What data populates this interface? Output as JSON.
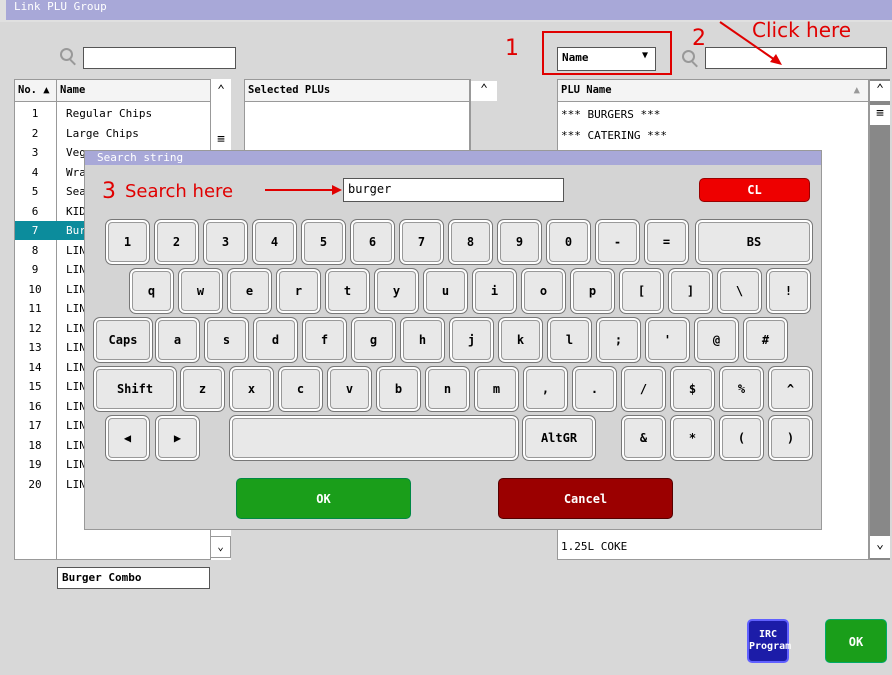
{
  "window": {
    "title": "Link PLU Group"
  },
  "left": {
    "headers": {
      "no": "No.",
      "name": "Name",
      "selected": "Selected PLUs"
    },
    "rows": [
      {
        "no": "1",
        "name": "Regular Chips"
      },
      {
        "no": "2",
        "name": "Large Chips"
      },
      {
        "no": "3",
        "name": "Veg"
      },
      {
        "no": "4",
        "name": "Wra"
      },
      {
        "no": "5",
        "name": "Sea"
      },
      {
        "no": "6",
        "name": "KID"
      },
      {
        "no": "7",
        "name": "Bur"
      },
      {
        "no": "8",
        "name": "LIN"
      },
      {
        "no": "9",
        "name": "LIN"
      },
      {
        "no": "10",
        "name": "LIN"
      },
      {
        "no": "11",
        "name": "LIN"
      },
      {
        "no": "12",
        "name": "LIN"
      },
      {
        "no": "13",
        "name": "LIN"
      },
      {
        "no": "14",
        "name": "LIN"
      },
      {
        "no": "15",
        "name": "LIN"
      },
      {
        "no": "16",
        "name": "LIN"
      },
      {
        "no": "17",
        "name": "LIN"
      },
      {
        "no": "18",
        "name": "LIN"
      },
      {
        "no": "19",
        "name": "LIN"
      },
      {
        "no": "20",
        "name": "LINK PLU GROUP 20"
      }
    ],
    "selected_index": 6,
    "group_name_value": "Burger Combo"
  },
  "right": {
    "filter_select": "Name",
    "search_value": "",
    "header": "PLU Name",
    "rows": [
      "*** BURGERS ***",
      "*** CATERING ***"
    ],
    "last_row": "1.25L COKE"
  },
  "dialog": {
    "title": "Search string",
    "value": "burger",
    "cl": "CL",
    "row1": [
      "1",
      "2",
      "3",
      "4",
      "5",
      "6",
      "7",
      "8",
      "9",
      "0",
      "-",
      "=",
      "BS"
    ],
    "row2": [
      "q",
      "w",
      "e",
      "r",
      "t",
      "y",
      "u",
      "i",
      "o",
      "p",
      "[",
      "]",
      "\\",
      "!"
    ],
    "row3": [
      "Caps",
      "a",
      "s",
      "d",
      "f",
      "g",
      "h",
      "j",
      "k",
      "l",
      ";",
      "'",
      "@",
      "#"
    ],
    "row4": [
      "Shift",
      "z",
      "x",
      "c",
      "v",
      "b",
      "n",
      "m",
      ",",
      ".",
      "/",
      "$",
      "%",
      "^"
    ],
    "row5": {
      "altgr": "AltGR",
      "keys": [
        "&",
        "*",
        "(",
        ")"
      ],
      "left": "◀",
      "right": "▶"
    },
    "ok": "OK",
    "cancel": "Cancel"
  },
  "footer": {
    "irc": "IRC Program",
    "ok": "OK"
  },
  "annotations": {
    "n1": "1",
    "n2": "2",
    "n3": "3",
    "click": "Click here",
    "search": "Search here"
  },
  "colors": {
    "selection": "#0c8c9c",
    "ok_green": "#1a9e1a",
    "cancel_red": "#9b0000",
    "cl_red": "#ee0000",
    "irc_blue": "#1c1ca8",
    "annotation": "#e00000"
  }
}
